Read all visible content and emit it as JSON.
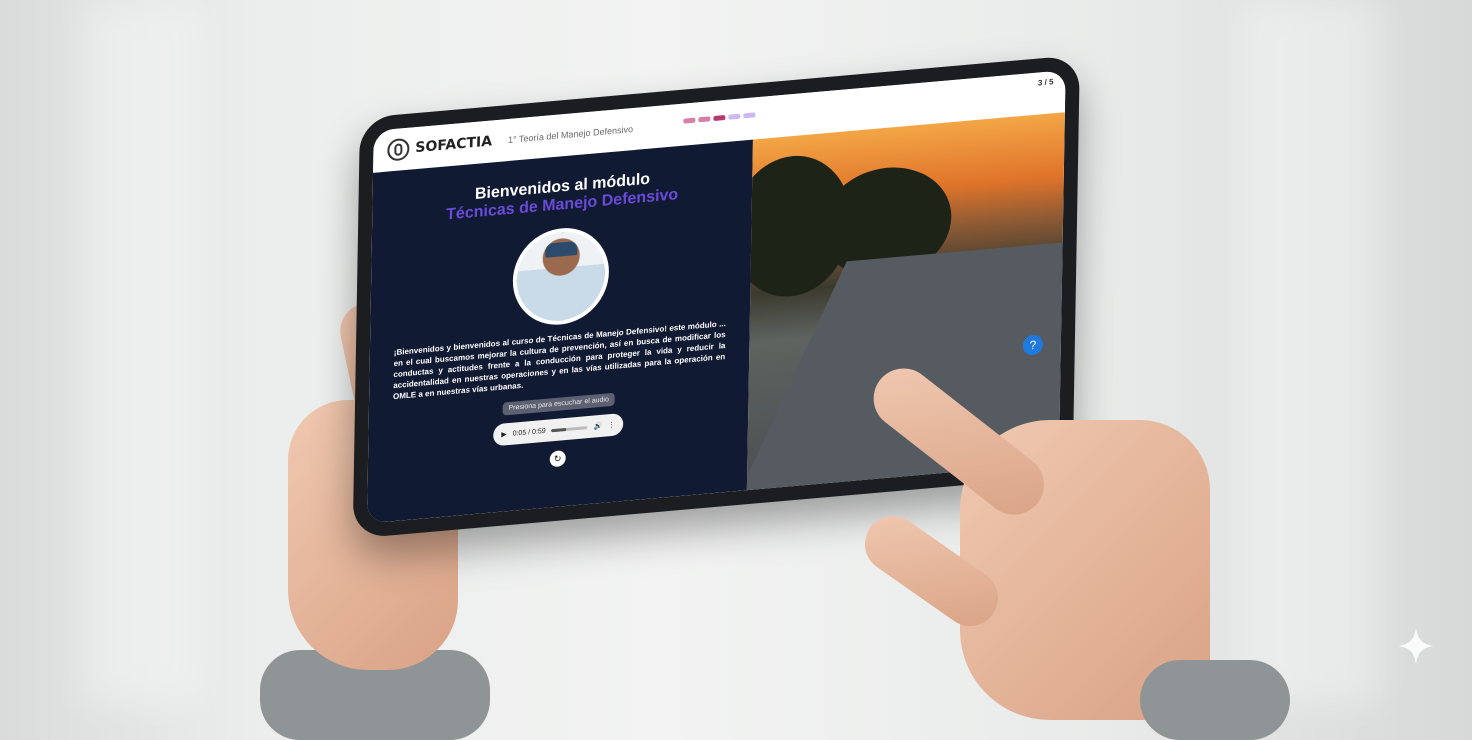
{
  "app": {
    "name": "SOFACTIA",
    "lesson": "1° Teoría del Manejo Defensivo",
    "page_counter": "3 / 5"
  },
  "progress_colors": [
    "#d67fa8",
    "#d67fa8",
    "#b43a6f",
    "#cdb9ef",
    "#cdb9ef"
  ],
  "hero": {
    "title": "Bienvenidos al módulo",
    "subtitle": "Técnicas de Manejo Defensivo",
    "description": "¡Bienvenidos y bienvenidos al curso de Técnicas de Manejo Defensivo! este módulo ... en el cual buscamos mejorar la cultura de prevención, así en busca de modificar los conductas y actitudes frente a la conducción para proteger la vida y reducir la accidentalidad en nuestras operaciones y en las vías utilizadas para la operación en OMLE a en nuestras vías urbanas.",
    "hint": "Presiona para escuchar el audio",
    "audio_time": "0:05 / 0:59",
    "replay_label": "↻"
  },
  "accent": "#6a4bd8",
  "icons": [
    "sofactia-logo-icon",
    "play-icon",
    "volume-icon",
    "more-icon",
    "replay-icon",
    "help-icon"
  ]
}
